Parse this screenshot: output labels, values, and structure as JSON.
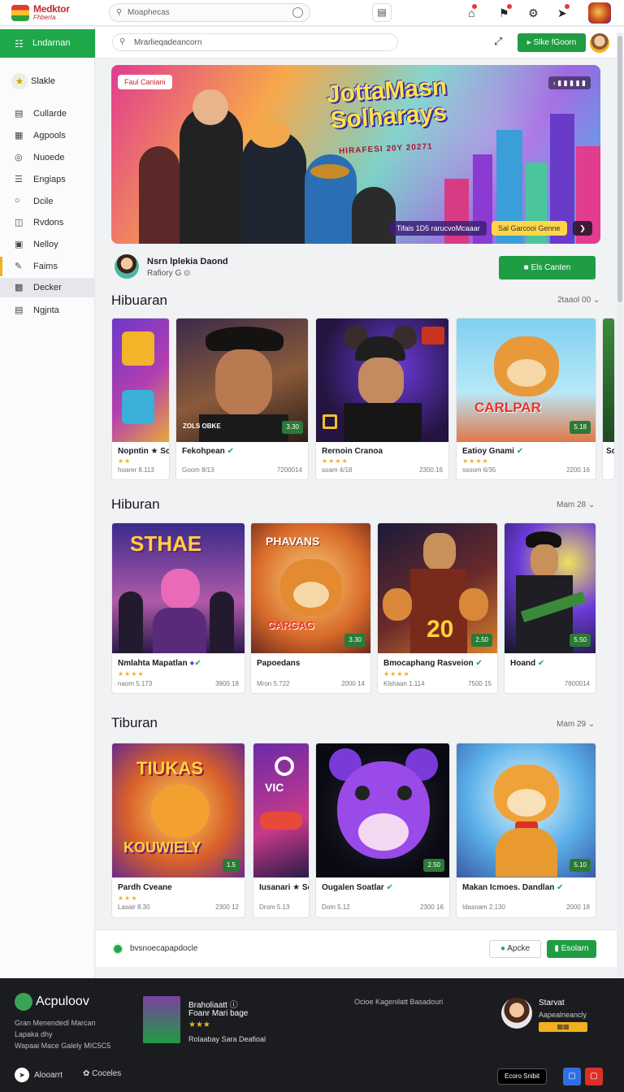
{
  "topbar": {
    "logo_title": "Medktor",
    "logo_sub": "Fhberta",
    "search_placeholder": "Moaphecas",
    "icons": [
      "home-icon",
      "bell-icon",
      "gear-icon",
      "rocket-icon"
    ]
  },
  "sidebar": {
    "top_label": "Lndarnan",
    "star_label": "Slakle",
    "items": [
      {
        "label": "Cullarde",
        "icon": "document-icon"
      },
      {
        "label": "Agpools",
        "icon": "calendar-icon"
      },
      {
        "label": "Nuoede",
        "icon": "circle-icon"
      },
      {
        "label": "Engiaps",
        "icon": "list-icon"
      },
      {
        "label": "Dcile",
        "icon": "circle-icon"
      },
      {
        "label": "Rvdons",
        "icon": "grid-icon"
      },
      {
        "label": "Nelloy",
        "icon": "bookmark-icon"
      },
      {
        "label": "Faims",
        "icon": "folder-icon"
      },
      {
        "label": "Decker",
        "icon": "layers-icon"
      },
      {
        "label": "Ngjnta",
        "icon": "tag-icon"
      }
    ]
  },
  "content_bar": {
    "search_value": "Mrarlieqadeancorn",
    "button": "Slke fGoorn"
  },
  "hero": {
    "tag": "Faul Caniani",
    "pager": "‹ ▮ ▮ ▮ ▮ ▮",
    "title": "JottaMasn Solharays",
    "subtitle": "HIRAFESI 20Y 20271",
    "badge": "Tifais 1D5 rarucvoMcaaar",
    "button": "Sal Garcooi Genne",
    "arrow": "❯"
  },
  "featured": {
    "name": "Nsrn lplekia Daond",
    "sub": "Rafiory G ⊙"
  },
  "featured_button": "Els Canten",
  "sections": [
    {
      "title": "Hibuaran",
      "more": "2taaol 00",
      "cards": [
        {
          "name": "Nopntin ★ Sc",
          "stars": "★★",
          "m1": "hoarer 8.113",
          "m2": "",
          "price": ""
        },
        {
          "name": "Fekohpean",
          "stars": "",
          "m1": "Goom 8/13",
          "m2": "7200014",
          "price": "3.30"
        },
        {
          "name": "Rernoin Cranoa",
          "stars": "★★★★",
          "m1": "soam 4/18",
          "m2": "2300.16",
          "price": ""
        },
        {
          "name": "Eatioy Gnami",
          "stars": "★★★★",
          "m1": "ssoom 6/35",
          "m2": "2200.16",
          "price": "5.18"
        },
        {
          "name": "Sc",
          "stars": "",
          "m1": "",
          "m2": "",
          "price": ""
        }
      ]
    },
    {
      "title": "Hiburan",
      "more": "Mam 28",
      "cards": [
        {
          "name": "Nmlahta Mapatlan",
          "stars": "★★★★",
          "m1": "naom 5.173",
          "m2": "3900.18",
          "price": ""
        },
        {
          "name": "Papoedans",
          "stars": "",
          "m1": "Mron 5.722",
          "m2": "2000 14",
          "price": "3.30"
        },
        {
          "name": "Bmocaphang Rasveion",
          "stars": "★★★★",
          "m1": "Klshaan 1.114",
          "m2": "7500 15",
          "price": "2.50"
        },
        {
          "name": "Hoand",
          "stars": "",
          "m1": "",
          "m2": "7800014",
          "price": "5.50"
        }
      ]
    },
    {
      "title": "Tiburan",
      "more": "Mam 29",
      "cards": [
        {
          "name": "Pardh Cveane",
          "stars": "★★★",
          "m1": "Lasair 8.30",
          "m2": "2300 12",
          "price": "1.5"
        },
        {
          "name": "Iusanari ★ Sc",
          "stars": "",
          "m1": "Drom 5.13",
          "m2": "",
          "price": ""
        },
        {
          "name": "Ougalen Soatlar",
          "stars": "",
          "m1": "Dom 5.12",
          "m2": "2300 16",
          "price": "2.50"
        },
        {
          "name": "Makan Icmoes. Dandlan",
          "stars": "",
          "m1": "Idasnam 2.130",
          "m2": "2000 18",
          "price": "5.10"
        }
      ]
    }
  ],
  "bottom_banner": {
    "text": "bvsnoecapapdocle",
    "outline_button": "Apcke",
    "green_button": "Esolarn"
  },
  "footer": {
    "logo": "Acpuloov",
    "desc1": "Gran Menendedl Marcan",
    "desc2": "Lapaka dhy",
    "desc3": "Wapaai Mace Galely MIC5C5",
    "mini_title": "Braholiaatt",
    "mini_sub": "Foanr Mari bage",
    "mini_stars": "★★★",
    "mini_bottom": "Rolaabay Sara Deafioal",
    "mid": "Ocioe Kagenilatt Basadouri",
    "author": "Starvat",
    "author_sub": "Aapealneancly",
    "link1": "Alooarrt",
    "link2": "Coceles",
    "pill": "Ecoro Snibit"
  },
  "colors": {
    "accent_green": "#1fa84a",
    "star_yellow": "#f0b020",
    "footer_bg": "#1b1c20"
  }
}
